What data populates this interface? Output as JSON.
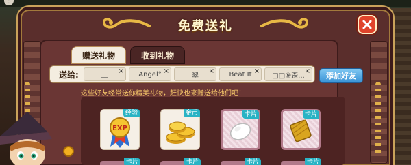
{
  "title": "免费送礼",
  "corner_badge": "0",
  "tabs": [
    {
      "label": "赠送礼物",
      "active": true
    },
    {
      "label": "收到礼物",
      "active": false
    }
  ],
  "recipients": {
    "label": "送给:",
    "chips": [
      "__",
      "Angel°",
      "翠",
      "Beat It",
      "□□⑨歪..."
    ],
    "close_glyph": "×"
  },
  "add_friend_label": "添加好友",
  "hint": "这些好友经常送你精美礼物，赶快也来赠送给他们吧！",
  "gifts": [
    {
      "tag": "经验",
      "icon": "exp-medal-icon",
      "style": "plain"
    },
    {
      "tag": "金币",
      "icon": "gold-coins-icon",
      "style": "plain"
    },
    {
      "tag": "卡片",
      "icon": "white-pill-icon",
      "style": "card"
    },
    {
      "tag": "卡片",
      "icon": "golden-spool-icon",
      "style": "card"
    }
  ],
  "gifts_row2_tags": [
    "卡片",
    "卡片",
    "卡片",
    "卡片"
  ],
  "exp_text": "EXP",
  "colors": {
    "accent_blue": "#3a93d6",
    "tag_cyan": "#29b3c4",
    "close_red": "#e0442b",
    "panel": "#5a2e2c",
    "hint": "#f6c86a"
  }
}
